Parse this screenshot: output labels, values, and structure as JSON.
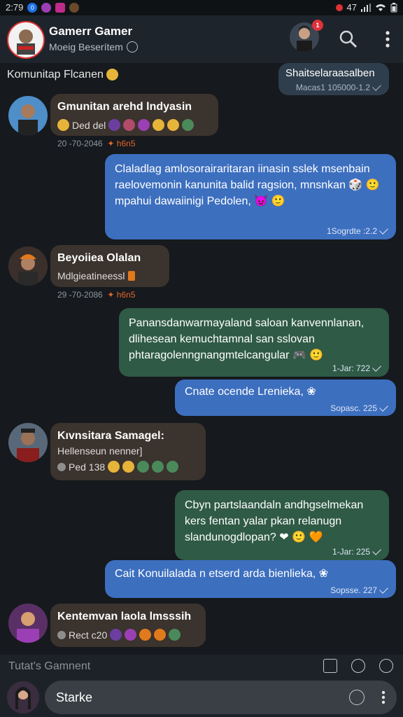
{
  "status_bar": {
    "time": "2:79",
    "right_text": "47"
  },
  "header": {
    "title": "Gamerr Gamer",
    "subtitle": "Moeig Beserítem",
    "notif_count": "1"
  },
  "section_label": "Komunitap Flcanen",
  "messages": [
    {
      "id": "m0",
      "text": "Shaitselaraasalben",
      "time": "Macas1 105000-1.2"
    },
    {
      "id": "m1",
      "name": "Gmunitan arehd lndyasin",
      "sub": "Ded del",
      "meta": "20 -70-2046",
      "flag": "h6n5"
    },
    {
      "id": "m2",
      "text": "Claladlag amlosorairaritaran iinasin sslek msenbain raelovemonin kanunita balid ragsion, mnsnkan 🎲 🙂 mpahui dawaiinigi Pedolen, 😈 🙂",
      "time": "1Sogrdte :2.2"
    },
    {
      "id": "m3",
      "name": "Beyoiiea Olalan",
      "sub": "Mdlgieatineessl",
      "meta": "29 -70-2086",
      "flag": "h6n5"
    },
    {
      "id": "m4",
      "text": "Panansdanwarmayaland saloan kanvennlanan, dlihesean kemuchtamnal san sslovan phtaragolenngnangmtelcangular 🎮 🙂",
      "time": "1-Jar: 722"
    },
    {
      "id": "m5",
      "text": "Cnate ocende Lrenieka, ❀",
      "time": "Sopasc. 225"
    },
    {
      "id": "m6",
      "name": "Kıvnsitara Samagel:",
      "sub_top": "Hellenseun nenner]",
      "sub": "Ped 138"
    },
    {
      "id": "m7",
      "text": "Cbyn partslaandaln andhgselmekan kers fentan yalar pkan relanugn slandunogdlopan? ❤ 🙂 🧡",
      "time": "1-Jar: 225"
    },
    {
      "id": "m8",
      "text": "Cait Konuilalada n etserd arda bienlieka, ❀",
      "time": "Sopsse. 227"
    },
    {
      "id": "m9",
      "name": "Kentemvan laola lmsssih",
      "sub": "Rect c20"
    }
  ],
  "composer": {
    "label": "Tutat's Gamnent",
    "input_value": "Starke"
  },
  "colors": {
    "bg": "#16191d",
    "blue": "#3d6fbf",
    "green": "#2f5a46",
    "incoming": "#3b332d"
  }
}
